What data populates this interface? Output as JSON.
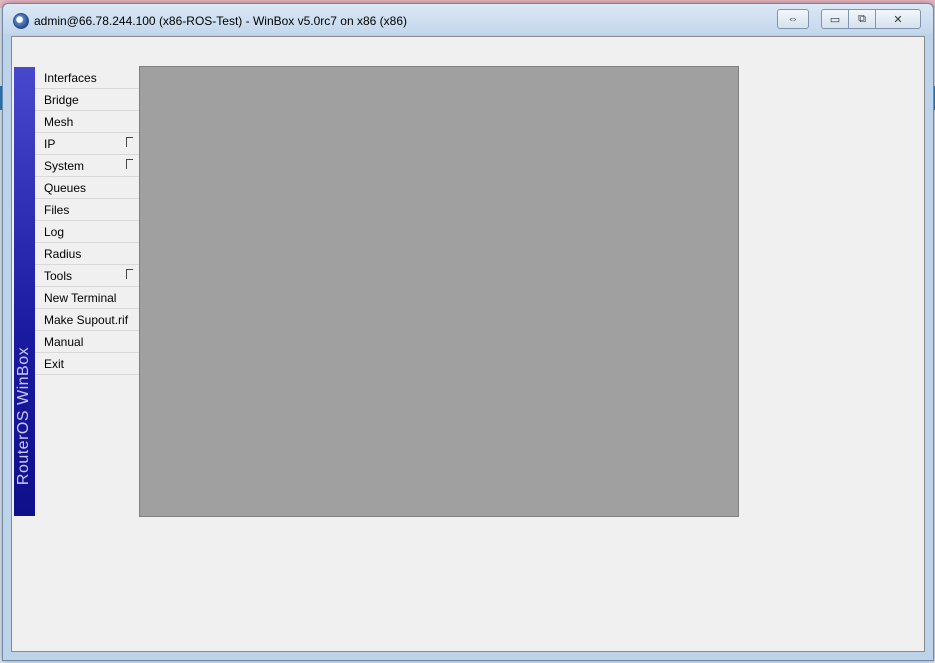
{
  "window": {
    "title": "admin@66.78.244.100 (x86-ROS-Test) - WinBox v5.0rc7 on x86 (x86)",
    "buttons": {
      "resize_glyph": "⇔",
      "minimize_glyph": "▭",
      "maximize_glyph": "⧉",
      "close_glyph": "✕"
    }
  },
  "sidebar": {
    "brand": "RouterOS WinBox",
    "brand_color": "#1a1aa0",
    "items": [
      {
        "label": "Interfaces",
        "submenu": false
      },
      {
        "label": "Bridge",
        "submenu": false
      },
      {
        "label": "Mesh",
        "submenu": false
      },
      {
        "label": "IP",
        "submenu": true
      },
      {
        "label": "System",
        "submenu": true
      },
      {
        "label": "Queues",
        "submenu": false
      },
      {
        "label": "Files",
        "submenu": false
      },
      {
        "label": "Log",
        "submenu": false
      },
      {
        "label": "Radius",
        "submenu": false
      },
      {
        "label": "Tools",
        "submenu": true
      },
      {
        "label": "New Terminal",
        "submenu": false
      },
      {
        "label": "Make Supout.rif",
        "submenu": false
      },
      {
        "label": "Manual",
        "submenu": false
      },
      {
        "label": "Exit",
        "submenu": false
      }
    ]
  },
  "icons": {
    "app": "winbox-app-icon",
    "submenu": "submenu-arrow-icon"
  }
}
